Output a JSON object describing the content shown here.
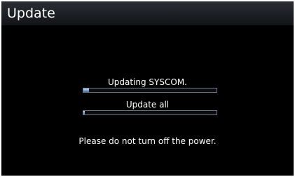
{
  "header": {
    "title": "Update"
  },
  "update": {
    "current_task": "Updating SYSCOM.",
    "current_progress": 0.04,
    "overall_task": "Update all",
    "overall_progress": 0.01,
    "warning": "Please do not turn off the power."
  },
  "colors": {
    "background": "#000000",
    "header_bg": "#1c1f24",
    "text": "#ffffff",
    "progress_fill": "#7fa6d8",
    "progress_border": "#6f7884"
  }
}
